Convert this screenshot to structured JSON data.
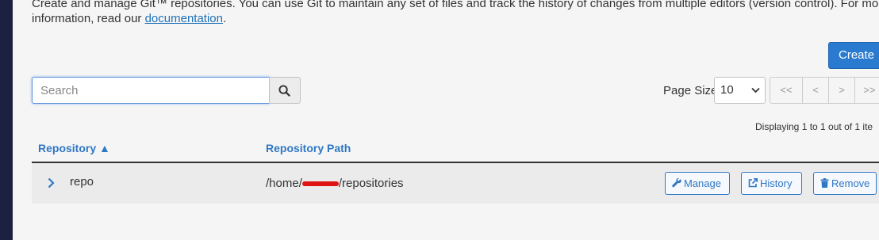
{
  "intro": {
    "line1": "Create and manage Git™ repositories. You can use Git to maintain any set of files and track the history of changes from multiple editors (version control). For more",
    "line2_prefix": "information, read our ",
    "link_text": "documentation",
    "line2_suffix": "."
  },
  "toolbar": {
    "create_label": "Create",
    "search_placeholder": "Search",
    "page_size_label": "Page Size",
    "page_size_value": "10",
    "pager": {
      "first": "<<",
      "prev": "<",
      "next": ">",
      "last": ">>"
    },
    "display_info": "Displaying 1 to 1 out of 1 ite"
  },
  "table": {
    "columns": {
      "repository": "Repository ▲",
      "path": "Repository Path"
    },
    "rows": [
      {
        "name": "repo",
        "path_prefix": "/home/",
        "path_suffix": "/repositories",
        "actions": {
          "manage": "Manage",
          "history": "History",
          "remove": "Remove"
        }
      }
    ]
  },
  "icons": {
    "search": "search-icon",
    "expand": "chevron-right-icon",
    "manage": "wrench-icon",
    "history": "external-link-icon",
    "remove": "trash-icon"
  },
  "colors": {
    "accent": "#2a7bd0",
    "link": "#1f72b8",
    "redaction": "#e01414",
    "sidebar": "#1c2142"
  }
}
